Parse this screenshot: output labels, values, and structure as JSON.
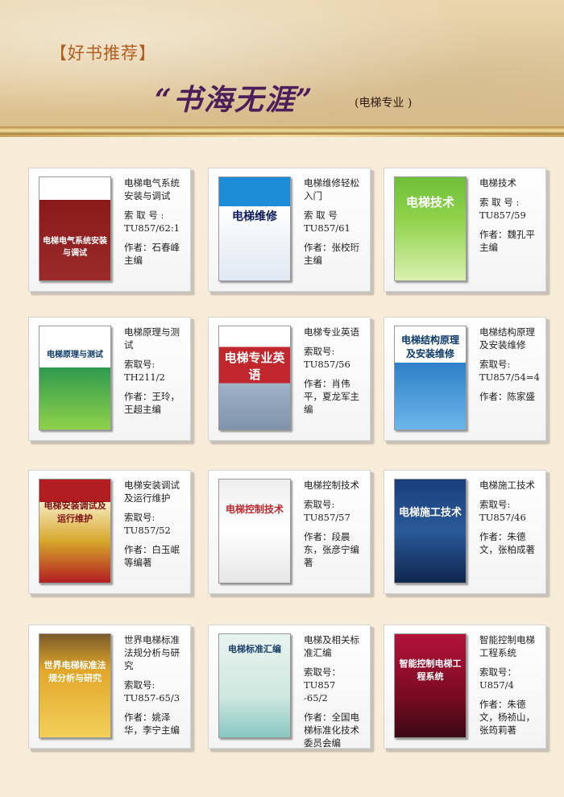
{
  "header": {
    "section_label": "【好书推荐】",
    "title": "“书海无涯”",
    "subtitle": "(电梯专业 )"
  },
  "books": [
    {
      "title": "电梯电气系统安装与调试",
      "call_label": "索 取 号 :",
      "call_number": "TU857/62:1",
      "author": "作者：石春峰主编",
      "cover_text": "电梯电气系统安装与调试",
      "cover_color": "#8a1a1a"
    },
    {
      "title": "电梯维修轻松入门",
      "call_label": "索 取 号",
      "call_number": "TU857/61",
      "author": "作者：张校珩主编",
      "cover_text": "电梯维修",
      "cover_color": "#1c8ed8"
    },
    {
      "title": "电梯技术",
      "call_label": "索 取 号 :",
      "call_number": "TU857/59",
      "author": "作者：魏孔平主编",
      "cover_text": "电梯技术",
      "cover_color": "#6fbf3a"
    },
    {
      "title": "电梯原理与测试",
      "call_label": "索取号:",
      "call_number": "TH211/2",
      "author": "作者：王玲，王超主编",
      "cover_text": "电梯原理与测试",
      "cover_color": "#2f9a4e"
    },
    {
      "title": "电梯专业英语",
      "call_label": "索取号:",
      "call_number": "TU857/56",
      "author": "作者：肖伟平，夏龙军主编",
      "cover_text": "电梯专业英语",
      "cover_color": "#c0282d"
    },
    {
      "title": "电梯结构原理及安装维修",
      "call_label": "索取号:",
      "call_number": "TU857/54=4",
      "author": "作者：陈家盛",
      "cover_text": "电梯结构原理及安装维修",
      "cover_color": "#2d7fc8"
    },
    {
      "title": "电梯安装调试及运行维护",
      "call_label": "索取号:",
      "call_number": "TU857/52",
      "author": "作者：白玉岷等编著",
      "cover_text": "电梯安装调试及运行维护",
      "cover_color": "#b21d21"
    },
    {
      "title": "电梯控制技术",
      "call_label": "索取号:",
      "call_number": "TU857/57",
      "author": "作者：段晨东，张彦宁编著",
      "cover_text": "电梯控制技术",
      "cover_color": "#efefef"
    },
    {
      "title": "电梯施工技术",
      "call_label": "索取号:",
      "call_number": "TU857/46",
      "author": "作者：朱德文，张柏成著",
      "cover_text": "电梯施工技术",
      "cover_color": "#1a3e7a"
    },
    {
      "title": "世界电梯标准法规分析与研究",
      "call_label": "索取号:",
      "call_number": "TU857-65/3",
      "author": "作者：姚泽华，李宁主编",
      "cover_text": "世界电梯标准法规分析与研究",
      "cover_color": "#e1a72a"
    },
    {
      "title": "电梯及相关标准汇编",
      "call_label": "索取号：TU857",
      "call_number": "-65/2",
      "author": "作者：全国电梯标准化技术委员会编",
      "cover_text": "电梯标准汇编",
      "cover_color": "#e9f3ef"
    },
    {
      "title": "智能控制电梯工程系统",
      "call_label": "索取号：",
      "call_number": "U857/4",
      "author": "作者：朱德文，杨祯山，张筠莉著",
      "cover_text": "智能控制电梯工程系统",
      "cover_color": "#b2123a"
    }
  ]
}
